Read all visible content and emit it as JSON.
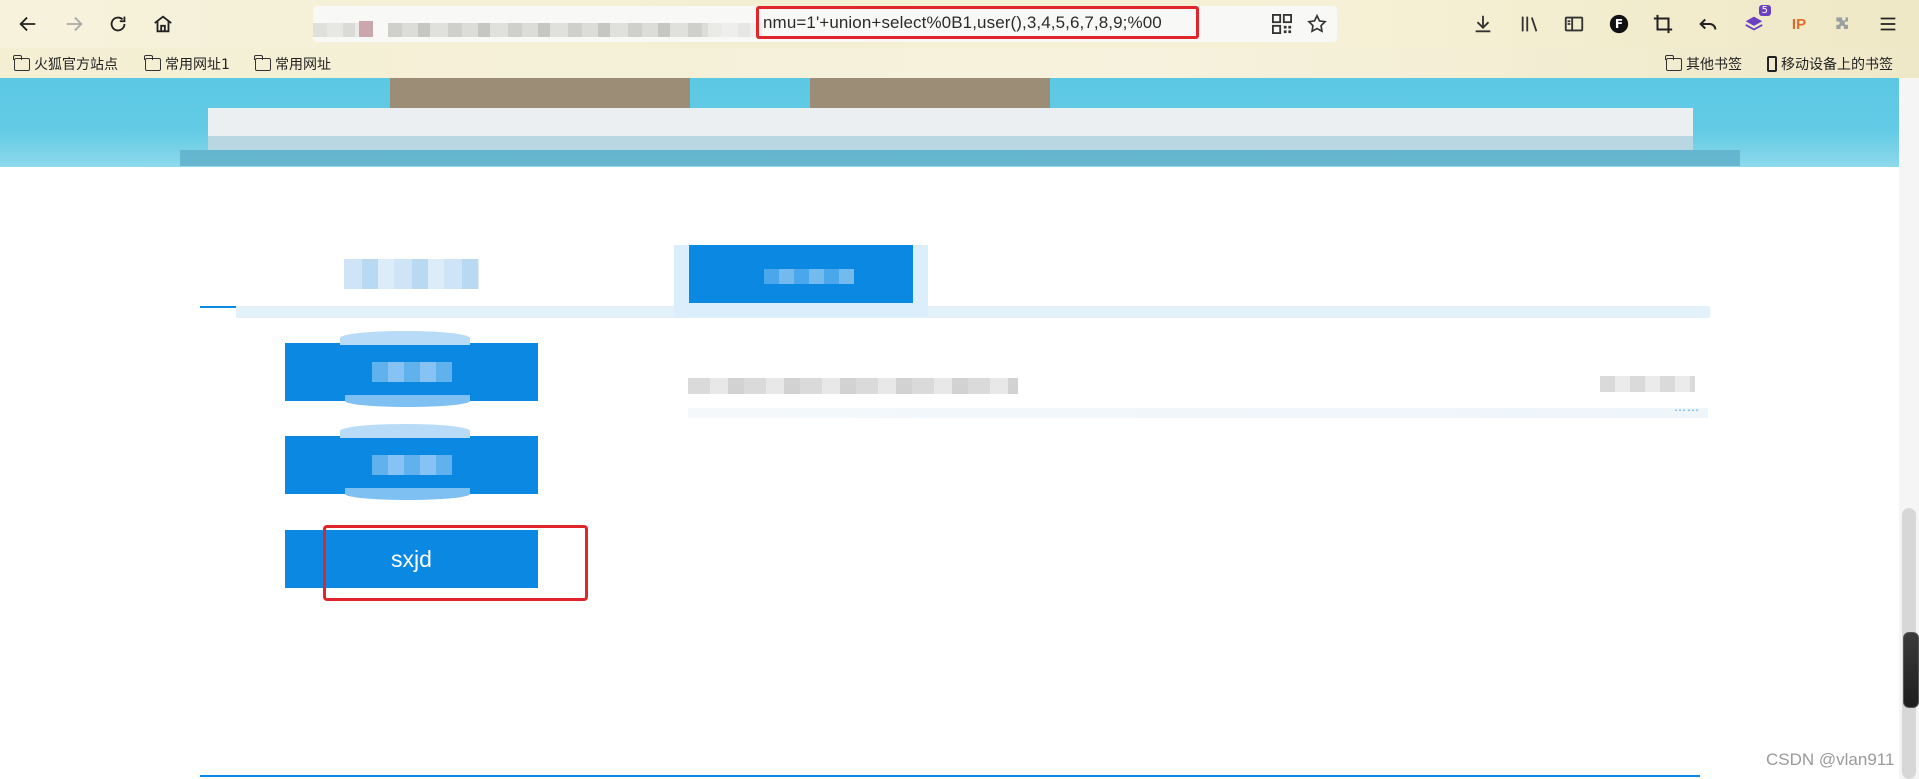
{
  "browser": {
    "url_visible": "nmu=1'+union+select%0B1,user(),3,4,5,6,7,8,9;%00",
    "badge_count": "5",
    "ip_badge": "IP",
    "profile_initial": "F",
    "icons": {
      "back": "arrow-left-icon",
      "forward": "arrow-right-icon",
      "reload": "reload-icon",
      "home": "home-icon",
      "qr": "qr-code-icon",
      "bookmark": "star-icon",
      "download": "download-icon",
      "library": "library-icon",
      "sidebar": "sidebar-icon",
      "menu": "menu-icon"
    }
  },
  "bookmarks": {
    "items": [
      "火狐官方站点",
      "常用网址1",
      "常用网址"
    ],
    "other": "其他书签",
    "mobile": "移动设备上的书签"
  },
  "page": {
    "buttons": [
      {
        "label": ""
      },
      {
        "label": ""
      },
      {
        "label": "sxjd"
      }
    ],
    "more": "……"
  },
  "watermark": "CSDN @vlan911",
  "colors": {
    "primary_blue": "#0b89e2",
    "banner_cyan": "#5cc8e3",
    "highlight_red": "#e0262a"
  }
}
